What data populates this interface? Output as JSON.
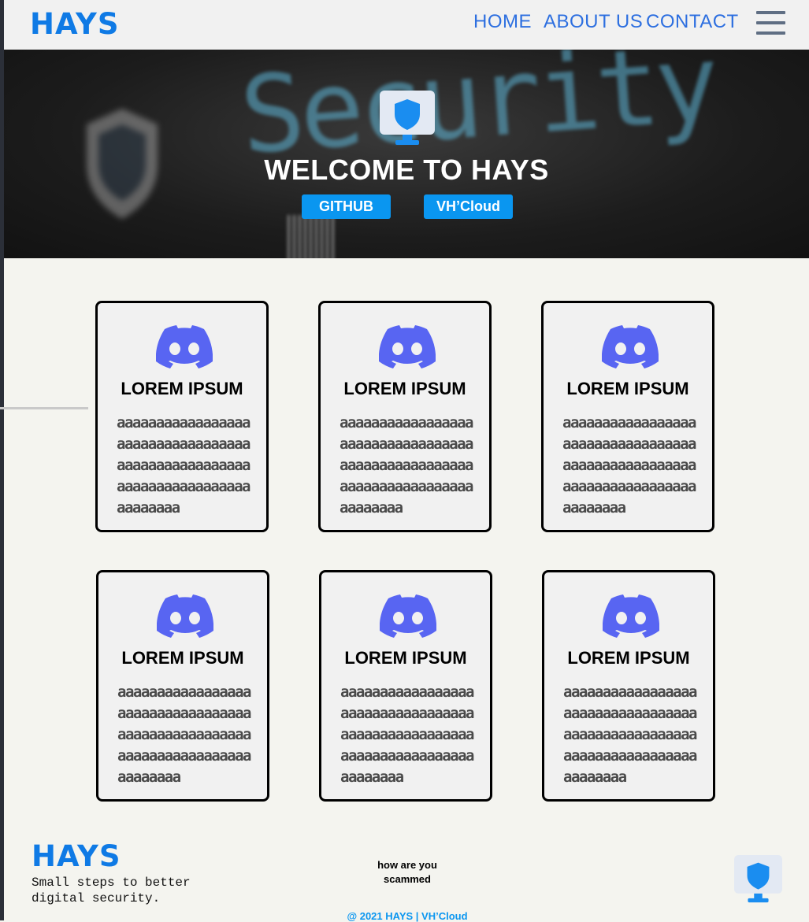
{
  "header": {
    "logo": "HAYS",
    "nav": {
      "home": "HOME",
      "about": "ABOUT US",
      "contact": "CONTACT"
    }
  },
  "hero": {
    "background_text": "Security",
    "title": "WELCOME TO HAYS",
    "buttons": {
      "github": "GITHUB",
      "vhcloud": "VH’Cloud"
    }
  },
  "cards": [
    {
      "title": "LOREM IPSUM",
      "text": "aaaaaaaaaaaaaaaaaaaaaaaaaaaaaaaaaaaaaaaaaaaaaaaaaaaaaaaaaaaaaaaaaaaaaaaaaaaa"
    },
    {
      "title": "LOREM IPSUM",
      "text": "aaaaaaaaaaaaaaaaaaaaaaaaaaaaaaaaaaaaaaaaaaaaaaaaaaaaaaaaaaaaaaaaaaaaaaaaaaaa"
    },
    {
      "title": "LOREM IPSUM",
      "text": "aaaaaaaaaaaaaaaaaaaaaaaaaaaaaaaaaaaaaaaaaaaaaaaaaaaaaaaaaaaaaaaaaaaaaaaaaaaa"
    },
    {
      "title": "LOREM IPSUM",
      "text": "aaaaaaaaaaaaaaaaaaaaaaaaaaaaaaaaaaaaaaaaaaaaaaaaaaaaaaaaaaaaaaaaaaaaaaaaaaaa"
    },
    {
      "title": "LOREM IPSUM",
      "text": "aaaaaaaaaaaaaaaaaaaaaaaaaaaaaaaaaaaaaaaaaaaaaaaaaaaaaaaaaaaaaaaaaaaaaaaaaaaa"
    },
    {
      "title": "LOREM IPSUM",
      "text": "aaaaaaaaaaaaaaaaaaaaaaaaaaaaaaaaaaaaaaaaaaaaaaaaaaaaaaaaaaaaaaaaaaaaaaaaaaaa"
    }
  ],
  "footer": {
    "logo": "HAYS",
    "tagline": "Small steps to better digital security.",
    "link": "how are you scammed",
    "copyright": "@ 2021 HAYS | VH’Cloud"
  },
  "icons": {
    "brand": "shield-monitor-icon",
    "card": "discord-icon",
    "menu": "hamburger-menu-icon"
  },
  "colors": {
    "brand_blue": "#0f7ae5",
    "nav_blue": "#2d6fe0",
    "button_blue": "#0a96f0",
    "discord": "#5865f2",
    "page_bg": "#f4f4ef"
  }
}
